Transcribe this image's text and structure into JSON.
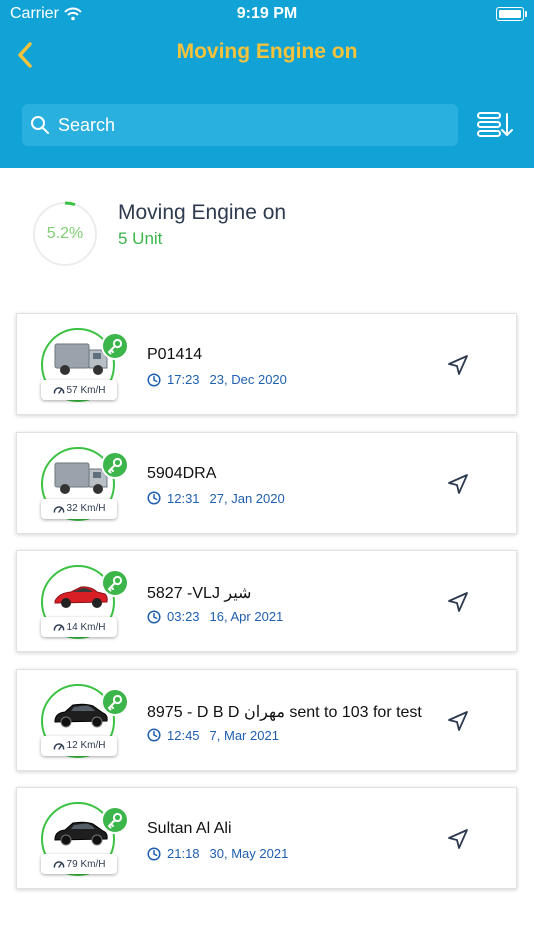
{
  "status_bar": {
    "carrier": "Carrier",
    "time": "9:19 PM"
  },
  "header": {
    "title": "Moving Engine on"
  },
  "search": {
    "placeholder": "Search"
  },
  "summary": {
    "percent": "5.2%",
    "percent_value": 0.052,
    "title": "Moving Engine on",
    "count": "5 Unit"
  },
  "colors": {
    "header_bg": "#11a3d6",
    "title": "#f5c33b",
    "accent_green": "#3cb54a",
    "timestamp_blue": "#1f5fb0"
  },
  "vehicles": [
    {
      "type": "truck",
      "speed": "57 Km/H",
      "plate": "P01414",
      "time": "17:23",
      "date": "23, Dec 2020"
    },
    {
      "type": "truck",
      "speed": "32 Km/H",
      "plate": "5904DRA",
      "time": "12:31",
      "date": "27, Jan 2020"
    },
    {
      "type": "red-sports-car",
      "speed": "14 Km/H",
      "plate": "5827 -VLJ شير",
      "time": "03:23",
      "date": "16, Apr 2021"
    },
    {
      "type": "black-sedan",
      "speed": "12 Km/H",
      "plate": "8975 - D B D مهران sent to 103 for test",
      "time": "12:45",
      "date": "7, Mar 2021"
    },
    {
      "type": "black-sedan",
      "speed": "79 Km/H",
      "plate": "Sultan Al Ali",
      "time": "21:18",
      "date": "30, May 2021"
    }
  ]
}
